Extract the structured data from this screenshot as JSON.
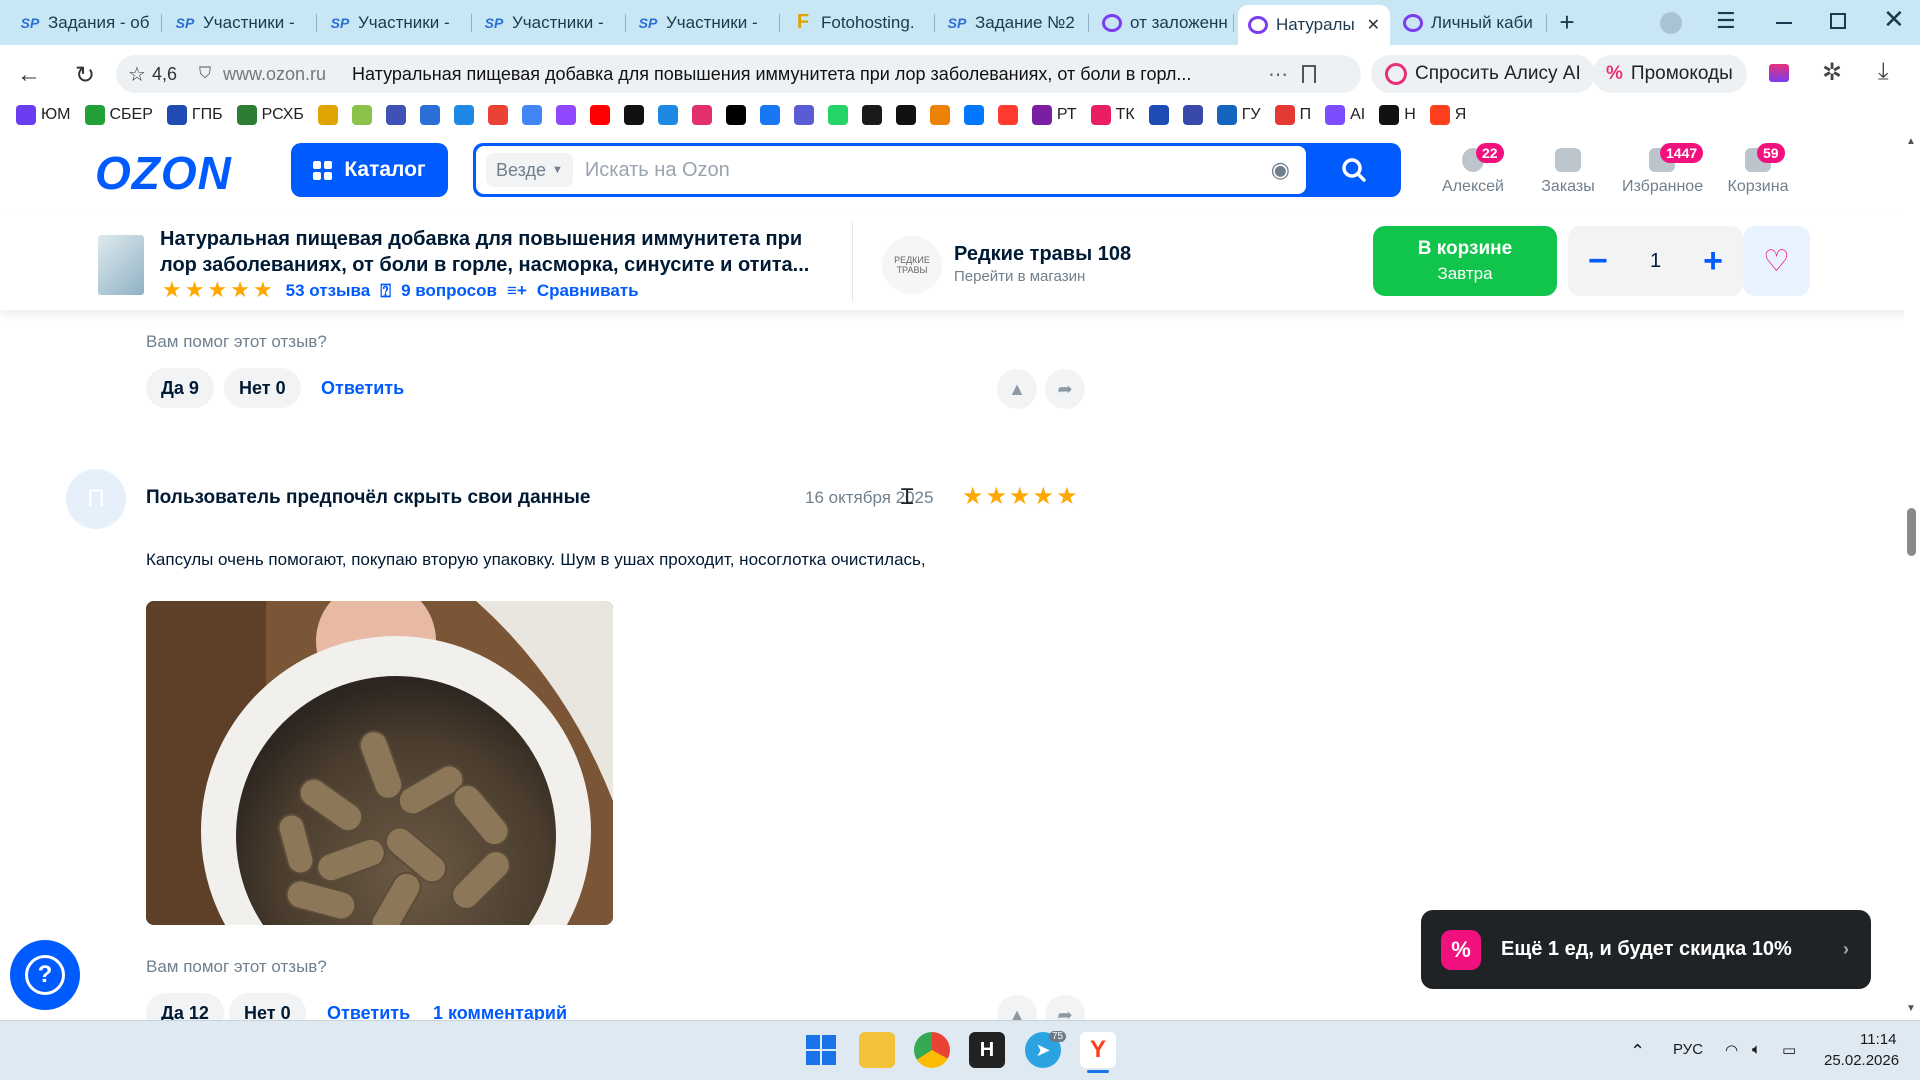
{
  "browser": {
    "tabs": [
      {
        "label": "Задания - об",
        "icon": "sp"
      },
      {
        "label": "Участники - ",
        "icon": "sp"
      },
      {
        "label": "Участники - ",
        "icon": "sp"
      },
      {
        "label": "Участники - ",
        "icon": "sp"
      },
      {
        "label": "Участники - ",
        "icon": "sp"
      },
      {
        "label": "Fotohosting.",
        "icon": "foto"
      },
      {
        "label": "Задание №2",
        "icon": "sp"
      },
      {
        "label": "от заложенн",
        "icon": "ya"
      },
      {
        "label": "Натуралы",
        "icon": "ya",
        "active": true
      },
      {
        "label": "Личный каби",
        "icon": "ya"
      }
    ],
    "rating": "4,6",
    "domain": "www.ozon.ru",
    "page_title": "Натуральная пищевая добавка для повышения иммунитета при лор заболеваниях, от боли в горл...",
    "alice_label": "Спросить Алису AI",
    "promocodes_label": "Промокоды",
    "bookmarks": [
      {
        "label": "ЮМ",
        "color": "#6b3df0"
      },
      {
        "label": "СБЕР",
        "color": "#21a038"
      },
      {
        "label": "ГПБ",
        "color": "#1e4bb4"
      },
      {
        "label": "РСХБ",
        "color": "#2e7d32"
      },
      {
        "label": "",
        "color": "#e0a400"
      },
      {
        "label": "",
        "color": "#8bc34a"
      },
      {
        "label": "",
        "color": "#3f51b5"
      },
      {
        "label": "",
        "color": "#2a6fd6"
      },
      {
        "label": "",
        "color": "#1e88e5"
      },
      {
        "label": "",
        "color": "#ea4335"
      },
      {
        "label": "",
        "color": "#4285f4"
      },
      {
        "label": "",
        "color": "#9146ff"
      },
      {
        "label": "",
        "color": "#ff0000"
      },
      {
        "label": "",
        "color": "#111111"
      },
      {
        "label": "",
        "color": "#1e88e5"
      },
      {
        "label": "",
        "color": "#e1306c"
      },
      {
        "label": "",
        "color": "#000000"
      },
      {
        "label": "",
        "color": "#1877f2"
      },
      {
        "label": "",
        "color": "#5b5bd6"
      },
      {
        "label": "",
        "color": "#25d366"
      },
      {
        "label": "",
        "color": "#1a1a1a"
      },
      {
        "label": "",
        "color": "#111111"
      },
      {
        "label": "",
        "color": "#ee8208"
      },
      {
        "label": "",
        "color": "#0077ff"
      },
      {
        "label": "",
        "color": "#ff3b30"
      },
      {
        "label": "РТ",
        "color": "#7b1fa2"
      },
      {
        "label": "ТК",
        "color": "#e91e63"
      },
      {
        "label": "",
        "color": "#1e4bb4"
      },
      {
        "label": "",
        "color": "#3949ab"
      },
      {
        "label": "ГУ",
        "color": "#1565c0"
      },
      {
        "label": "П",
        "color": "#e53935"
      },
      {
        "label": "AI",
        "color": "#7c4dff"
      },
      {
        "label": "Н",
        "color": "#111111"
      },
      {
        "label": "Я",
        "color": "#fc3f1d"
      }
    ]
  },
  "ozon_header": {
    "logo": "OZON",
    "catalog_label": "Каталог",
    "search_scope": "Везде",
    "search_placeholder": "Искать на Ozon",
    "icons": [
      {
        "label": "Алексей",
        "badge": "22"
      },
      {
        "label": "Заказы",
        "badge": ""
      },
      {
        "label": "Избранное",
        "badge": "1447"
      },
      {
        "label": "Корзина",
        "badge": "59"
      }
    ]
  },
  "product_bar": {
    "title": "Натуральная пищевая добавка для повышения иммунитета при лор заболеваниях, от боли в горле, насморка, синусите и отита...",
    "stars": 5,
    "reviews_link": "53 отзыва",
    "questions_link": "9 вопросов",
    "compare_link": "Сравнивать",
    "shop_logo_text": "РЕДКИЕ ТРАВЫ",
    "shop_name": "Редкие травы 108",
    "shop_link": "Перейти в магазин",
    "cart_label": "В корзине",
    "cart_sub": "Завтра",
    "quantity": "1"
  },
  "review_prev": {
    "helpful_question": "Вам помог этот отзыв?",
    "yes": "Да 9",
    "no": "Нет 0",
    "reply": "Ответить"
  },
  "review": {
    "avatar_letter": "П",
    "author": "Пользователь предпочёл скрыть свои данные",
    "date": "16 октября 2025",
    "stars": 5,
    "text": "Капсулы очень помогают, покупаю вторую упаковку. Шум в ушах проходит, носоглотка очистилась,",
    "helpful_question": "Вам помог этот отзыв?",
    "yes": "Да 12",
    "no": "Нет 0",
    "reply": "Ответить",
    "comments": "1 комментарий"
  },
  "promo": {
    "text": "Ещё 1 ед, и будет скидка 10%"
  },
  "taskbar": {
    "telegram_badge": "75",
    "language": "РУС",
    "time": "11:14",
    "date": "25.02.2026"
  },
  "colors": {
    "ozon_blue": "#005bff",
    "cart_green": "#10c44c",
    "badge_pink": "#f1117e",
    "star_orange": "#ffa800"
  }
}
